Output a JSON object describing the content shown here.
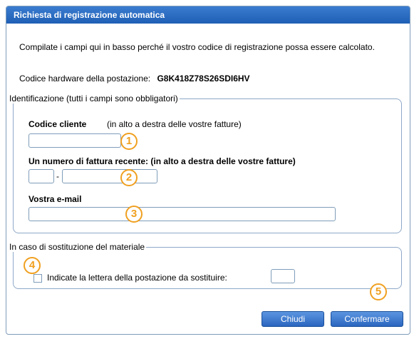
{
  "dialog": {
    "title": "Richiesta di registrazione automatica",
    "intro": "Compilate i campi qui in basso perché il vostro codice di registrazione possa essere calcolato.",
    "hardware_label": "Codice hardware della postazione:",
    "hardware_code": "G8K418Z78S26SDI6HV"
  },
  "identification": {
    "legend": "Identificazione (tutti i campi sono obbligatori)",
    "client_code_label": "Codice cliente",
    "client_code_hint": "(in alto a destra delle vostre fatture)",
    "client_code_value": "",
    "invoice_label": "Un numero di fattura recente: (in alto a destra delle vostre fatture)",
    "invoice_prefix_value": "",
    "invoice_dash": "-",
    "invoice_number_value": "",
    "email_label": "Vostra e-mail",
    "email_value": ""
  },
  "replacement": {
    "legend": "In caso di sostituzione del materiale",
    "checkbox_label": "Indicate la lettera della postazione da sostituire:",
    "checked": false,
    "letter_value": ""
  },
  "badges": [
    "1",
    "2",
    "3",
    "4",
    "5"
  ],
  "buttons": {
    "close": "Chiudi",
    "confirm": "Confermare"
  },
  "colors": {
    "title_bar": "#2a6cc4",
    "badge": "#f0a020",
    "button": "#3a76cf"
  }
}
